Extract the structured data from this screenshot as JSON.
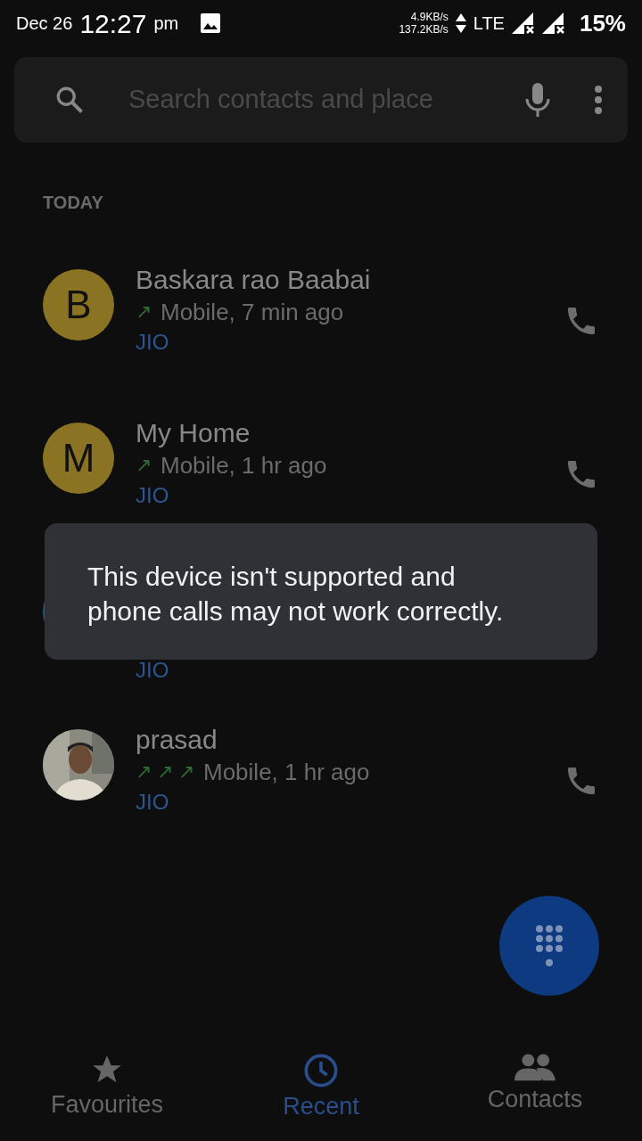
{
  "status_bar": {
    "date": "Dec 26",
    "time": "12:27",
    "ampm": "pm",
    "speed_up": "4.9KB/s",
    "speed_down": "137.2KB/s",
    "network": "LTE",
    "battery": "15%"
  },
  "search": {
    "placeholder": "Search contacts and place"
  },
  "section": "TODAY",
  "calls": [
    {
      "avatar": {
        "kind": "letter",
        "letter": "B",
        "color": "#8a7424"
      },
      "name": "Baskara rao Baabai",
      "arrows": [
        "↗"
      ],
      "detail": "Mobile, 7 min ago",
      "sim": "JIO"
    },
    {
      "avatar": {
        "kind": "letter",
        "letter": "M",
        "color": "#8a7424"
      },
      "name": "My Home",
      "arrows": [
        "↗"
      ],
      "detail": "Mobile, 1 hr ago",
      "sim": "JIO"
    },
    {
      "avatar": {
        "kind": "hidden",
        "color": "#1f5a7a"
      },
      "sim": "JIO"
    },
    {
      "avatar": {
        "kind": "picture"
      },
      "name": "prasad",
      "arrows": [
        "↗",
        "↗",
        "↗"
      ],
      "detail": "Mobile, 1 hr ago",
      "sim": "JIO"
    }
  ],
  "toast": "This device isn't supported and phone calls may not work correctly.",
  "tabs": [
    {
      "label": "Favourites",
      "kind": "star",
      "selected": false
    },
    {
      "label": "Recent",
      "kind": "clock",
      "selected": true
    },
    {
      "label": "Contacts",
      "kind": "people",
      "selected": false
    }
  ]
}
